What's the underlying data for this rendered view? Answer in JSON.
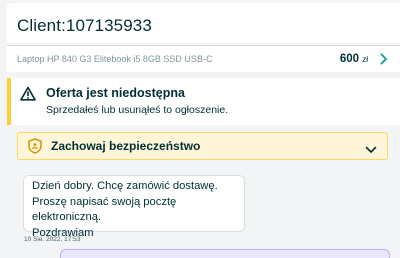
{
  "header": {
    "client": "Client:107135933"
  },
  "product": {
    "name": "Laptop HP 840 G3 Elitebook i5 8GB SSD USB-C",
    "price": "600",
    "currency": "zł"
  },
  "notice": {
    "title": "Oferta jest niedostępna",
    "subtitle": "Sprzedałeś lub usunąłeś to ogłoszenie."
  },
  "safety": {
    "label": "Zachowaj bezpieczeństwo"
  },
  "message": {
    "lines": [
      "Dzień dobry. Chcę zamówić dostawę.",
      "Proszę napisać swoją pocztę elektroniczną.",
      "Pozdrawiam"
    ],
    "time": "10 Sie. 2022, 17:53"
  },
  "colors": {
    "accent": "#23e5db",
    "warning": "#ffce32",
    "text": "#002f34"
  }
}
